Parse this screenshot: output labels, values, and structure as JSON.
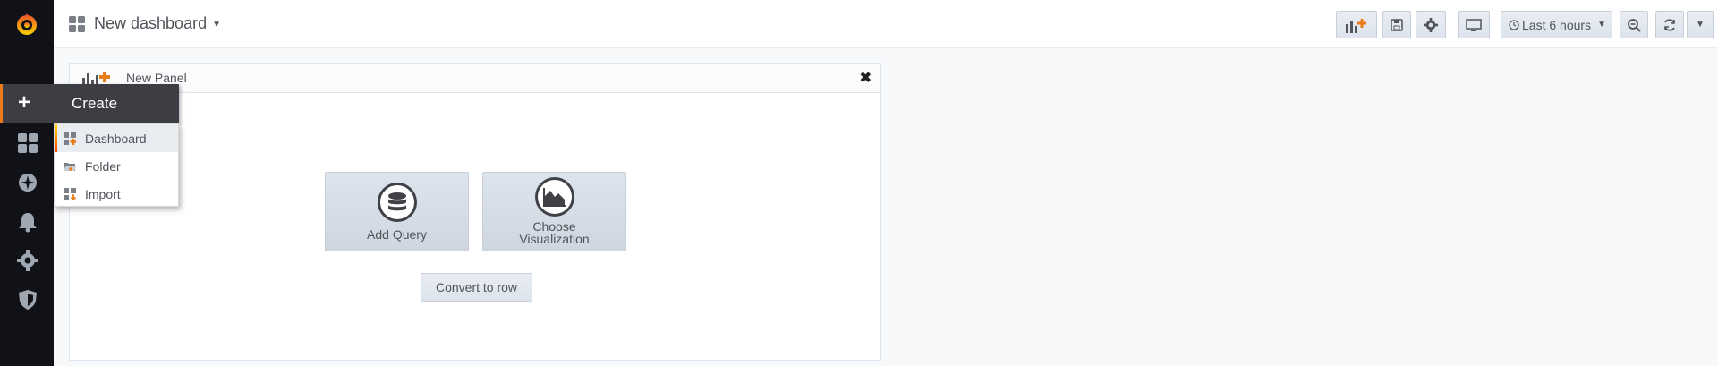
{
  "header": {
    "title": "New dashboard",
    "time_range": "Last 6 hours"
  },
  "panel": {
    "title": "New Panel",
    "add_query_label": "Add Query",
    "choose_vis_line1": "Choose",
    "choose_vis_line2": "Visualization",
    "convert_label": "Convert to row"
  },
  "create_menu": {
    "title": "Create",
    "items": [
      {
        "label": "Dashboard",
        "icon": "dashboard-icon"
      },
      {
        "label": "Folder",
        "icon": "folder-icon"
      },
      {
        "label": "Import",
        "icon": "import-icon"
      }
    ]
  },
  "sidebar": {
    "icons": [
      "grafana-logo",
      "plus-icon",
      "dashboards-icon",
      "explore-icon",
      "alerting-icon",
      "configuration-icon",
      "shield-icon"
    ]
  },
  "colors": {
    "sidebar_bg": "#111217",
    "accent": "#eb7b18",
    "panel_border": "#dde4ed"
  }
}
